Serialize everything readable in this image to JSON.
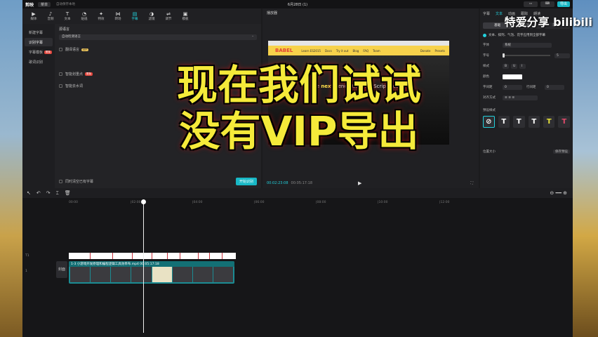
{
  "app": {
    "logo": "剪映",
    "menu": "菜单",
    "autosave": "自动保存本地",
    "title": "6月28日 (1)",
    "export": "导出"
  },
  "toolbar": [
    {
      "label": "媒体",
      "icon": "▶"
    },
    {
      "label": "音频",
      "icon": "♪"
    },
    {
      "label": "文本",
      "icon": "T"
    },
    {
      "label": "贴纸",
      "icon": "◔"
    },
    {
      "label": "特效",
      "icon": "✦"
    },
    {
      "label": "转场",
      "icon": "⋈"
    },
    {
      "label": "字幕",
      "icon": "▤"
    },
    {
      "label": "滤镜",
      "icon": "◑"
    },
    {
      "label": "调节",
      "icon": "⇌"
    },
    {
      "label": "模板",
      "icon": "▣"
    }
  ],
  "leftnav": {
    "new": "新建字幕",
    "recognize": "识别字幕",
    "lyrics": "字幕模板",
    "lyrics_badge": "限免",
    "lyric_rec": "歌词识别"
  },
  "panel": {
    "lang_label": "源语言",
    "lang_value": "自动检测语言",
    "opt1": "翻译语言",
    "opt1_tag": "VIP",
    "opt2": "智能划重点",
    "opt2_tag": "限免",
    "opt3": "智能去水词",
    "bottom_opt": "同时清空已有字幕",
    "start": "开始识别"
  },
  "player": {
    "title": "播放器",
    "site_logo": "BABEL",
    "site_links": [
      "Learn ES2015",
      "Docs",
      "Try it out",
      "Blog",
      "FAQ",
      "Team"
    ],
    "site_right": [
      "Donate",
      "Presets"
    ],
    "hero_pre": "Use ",
    "hero_bold": "next",
    "hero_post": " generation JavaScript, today",
    "tc": "00:02:23:08",
    "tc_total": "00:05:17:18"
  },
  "right": {
    "tabs": [
      "字幕",
      "文本",
      "动画",
      "跟踪",
      "朗读"
    ],
    "subtabs": [
      "基础",
      "气泡",
      "花字"
    ],
    "apply": "文本、排列、气泡、花字应用到全部字幕",
    "font_label": "字体",
    "font_value": "系统",
    "size_label": "字号",
    "size_value": "5",
    "style_label": "样式",
    "color_label": "颜色",
    "letter_label": "字间距",
    "letter_value": "0",
    "line_label": "行间距",
    "line_value": "0",
    "align_label": "对齐方式",
    "preset_label": "预设样式",
    "pos_label": "位置大小",
    "save_preset": "保存预设"
  },
  "timeline": {
    "ticks": [
      "00:00",
      "|02:00",
      "|04:00",
      "|06:00",
      "|08:00",
      "|10:00",
      "|12:00"
    ],
    "sub_track": "T1",
    "video_track": "1",
    "cover": "封面",
    "clip_name": "1-3 小游戏开发原理和编程逻辑工具效率布.mp4",
    "clip_dur": "00:05:17:18"
  },
  "overlay": {
    "line1": "现在我们试试",
    "line2": "没有VIP导出",
    "watermark": "特爱分享 bilibili"
  }
}
